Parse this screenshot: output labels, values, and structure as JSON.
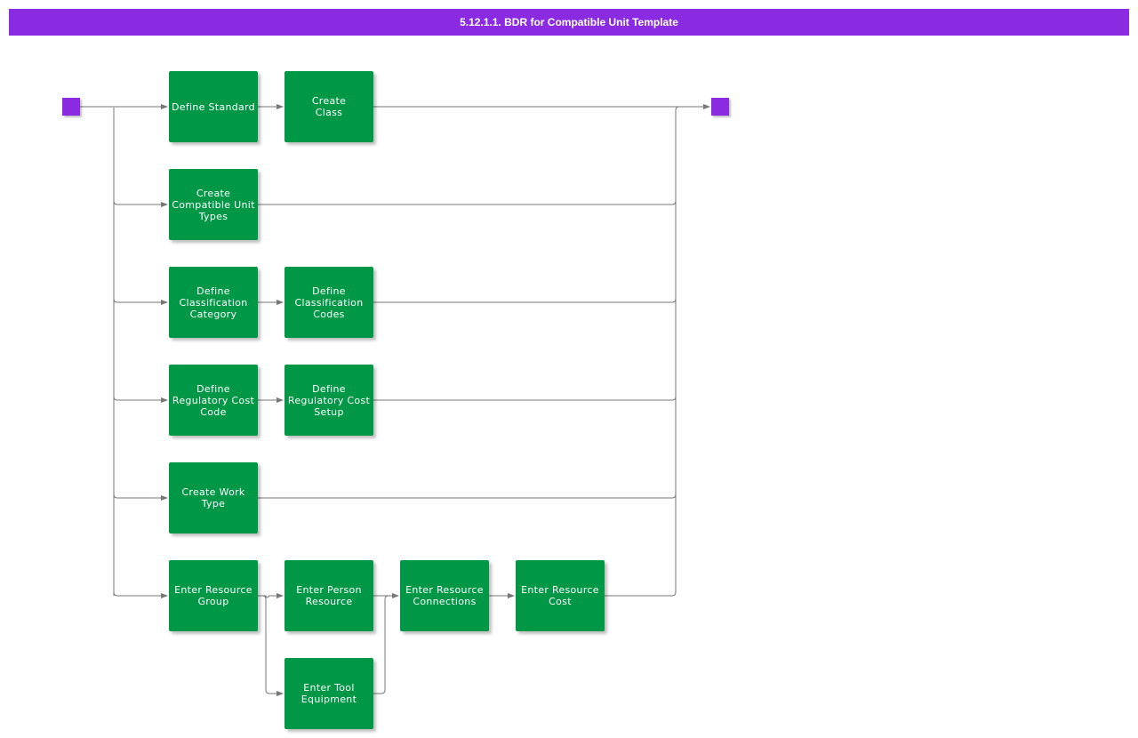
{
  "title": "5.12.1.1. BDR for Compatible Unit Template",
  "colors": {
    "title_bar": "#8a2be2",
    "terminal": "#8a2be2",
    "step": "#009846",
    "connector": "#777777"
  },
  "steps": {
    "define_standard": "Define Standard",
    "create_class": "Create\nClass",
    "create_compatible_unit_types": "Create\nCompatible Unit\nTypes",
    "define_classification_category": "Define\nClassification\nCategory",
    "define_classification_codes": "Define\nClassification\nCodes",
    "define_regulatory_cost_code": "Define\nRegulatory Cost\nCode",
    "define_regulatory_cost_setup": "Define\nRegulatory Cost\nSetup",
    "create_work_type": "Create Work\nType",
    "enter_resource_group": "Enter Resource\nGroup",
    "enter_person_resource": "Enter Person\nResource",
    "enter_tool_equipment": "Enter Tool\nEquipment",
    "enter_resource_connections": "Enter Resource\nConnections",
    "enter_resource_cost": "Enter Resource\nCost"
  }
}
